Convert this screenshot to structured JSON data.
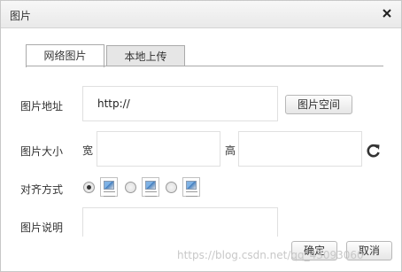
{
  "dialog": {
    "title": "图片",
    "close_glyph": "✕"
  },
  "tabs": [
    {
      "label": "网络图片",
      "active": true
    },
    {
      "label": "本地上传",
      "active": false
    }
  ],
  "form": {
    "url_label": "图片地址",
    "url_value": "http://",
    "browse_button": "图片空间",
    "size_label": "图片大小",
    "width_label": "宽",
    "height_label": "高",
    "width_value": "",
    "height_value": "",
    "refresh_icon": "refresh-icon",
    "align_label": "对齐方式",
    "align_options": [
      {
        "name": "default",
        "checked": true
      },
      {
        "name": "left",
        "checked": false
      },
      {
        "name": "right",
        "checked": false
      }
    ],
    "desc_label": "图片说明",
    "desc_value": ""
  },
  "footer": {
    "ok_button": "确定",
    "cancel_button": "取消"
  },
  "watermark": "https://blog.csdn.net/qq_43093060"
}
